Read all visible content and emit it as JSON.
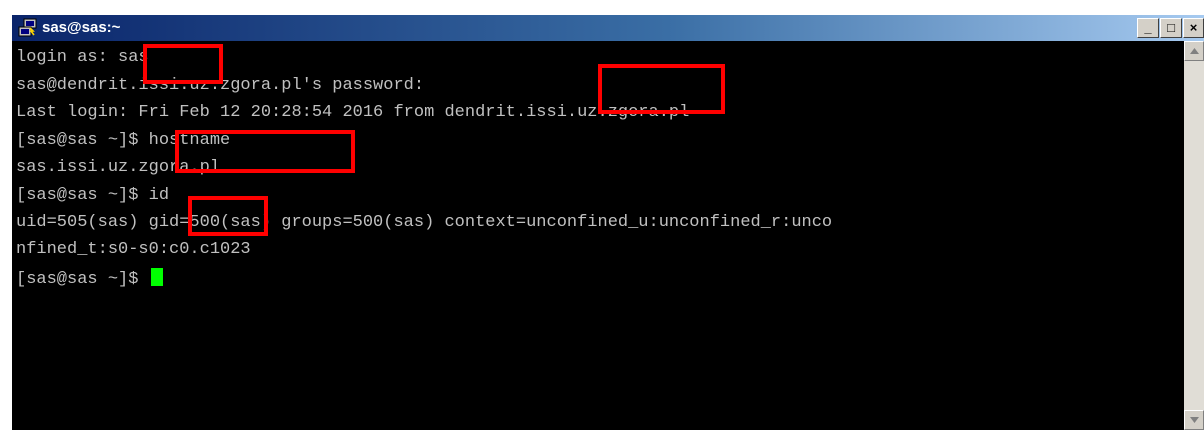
{
  "window": {
    "title": "sas@sas:~",
    "minimize_glyph": "_",
    "maximize_glyph": "□",
    "close_glyph": "×"
  },
  "terminal": {
    "lines": [
      "login as: sas",
      "sas@dendrit.issi.uz.zgora.pl's password:",
      "Last login: Fri Feb 12 20:28:54 2016 from dendrit.issi.uz.zgora.pl",
      "[sas@sas ~]$ hostname",
      "sas.issi.uz.zgora.pl",
      "[sas@sas ~]$ id",
      "uid=505(sas) gid=500(sas) groups=500(sas) context=unconfined_u:unconfined_r:unco",
      "nfined_t:s0-s0:c0.c1023",
      "[sas@sas ~]$ "
    ]
  },
  "colors": {
    "terminal_bg": "#000000",
    "terminal_text": "#c0c0c0",
    "cursor": "#00ff00",
    "highlight": "#ff0000",
    "titlebar": "#0a246a"
  },
  "icons": {
    "app": "putty-icon",
    "scroll_up": "scroll-up-arrow-icon",
    "scroll_down": "scroll-down-arrow-icon"
  }
}
